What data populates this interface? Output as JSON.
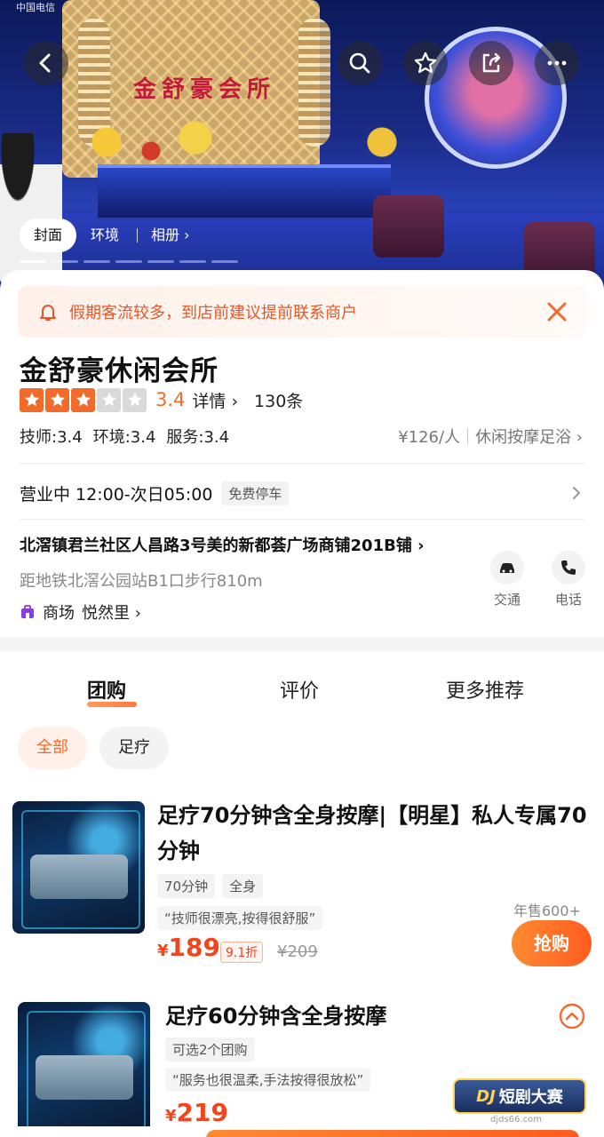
{
  "status_bar": {
    "text": "中国电信"
  },
  "hero": {
    "sign_text": "金舒豪会所",
    "tabs": [
      {
        "label": "封面",
        "active": true
      },
      {
        "label": "环境",
        "active": false
      },
      {
        "label": "相册 ›",
        "active": false
      }
    ],
    "nav_icons": [
      "back-icon",
      "search-icon",
      "star-icon",
      "share-icon",
      "more-icon"
    ]
  },
  "notice": {
    "text": "假期客流较多，到店前建议提前联系商户"
  },
  "shop": {
    "name": "金舒豪休闲会所",
    "stars": 3,
    "score": "3.4",
    "detail_label": "详情 ›",
    "review_count": "130条",
    "sub_scores": [
      "技师:3.4",
      "环境:3.4",
      "服务:3.4"
    ],
    "price": "¥126/人",
    "category": "休闲按摩足浴 ›"
  },
  "hours": {
    "text": "营业中 12:00-次日05:00",
    "parking": "免费停车"
  },
  "address": {
    "line": "北滘镇君兰社区人昌路3号美的新都荟广场商铺201B铺 ›",
    "metro": "距地铁北滘公园站B1口步行810m",
    "mall_label": "商场",
    "mall_name": "悦然里 ›"
  },
  "contacts": {
    "traffic": "交通",
    "phone": "电话"
  },
  "tabs": [
    "团购",
    "评价",
    "更多推荐"
  ],
  "chips": [
    "全部",
    "足疗"
  ],
  "deals": [
    {
      "title": "足疗70分钟含全身按摩|【明星】私人专属70分钟",
      "tags": [
        "70分钟",
        "全身"
      ],
      "quote": "“技师很漂亮,按得很舒服”",
      "currency": "¥",
      "price": "189",
      "discount": "9.1折",
      "original": "¥209",
      "sold": "年售600+",
      "buy_label": "抢购"
    },
    {
      "title": "足疗60分钟含全身按摩",
      "tags": [
        "可选2个团购"
      ],
      "quote": "“服务也很温柔,手法按得很放松”",
      "currency": "¥",
      "price": "219"
    }
  ],
  "watermark": {
    "dj": "DJ",
    "text": "短剧大赛",
    "url": "djds66.com"
  },
  "colors": {
    "accent": "#f26b2a",
    "price": "#f2451c",
    "notice_bg": "#fff0ea"
  }
}
